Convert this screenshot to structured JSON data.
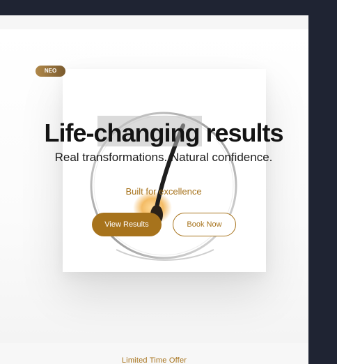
{
  "hero": {
    "badge": "NEO",
    "headline": "Life-changing results",
    "subhead": "Real transformations. Natural confidence.",
    "tagline": "Built for excellence",
    "primary_button": "View Results",
    "secondary_button": "Book Now"
  },
  "footer": {
    "offer": "Limited Time Offer"
  },
  "colors": {
    "accent": "#a7731c",
    "page_background": "#1f2433"
  },
  "icons": {
    "hero_image": "hair-follicle-illustration"
  }
}
